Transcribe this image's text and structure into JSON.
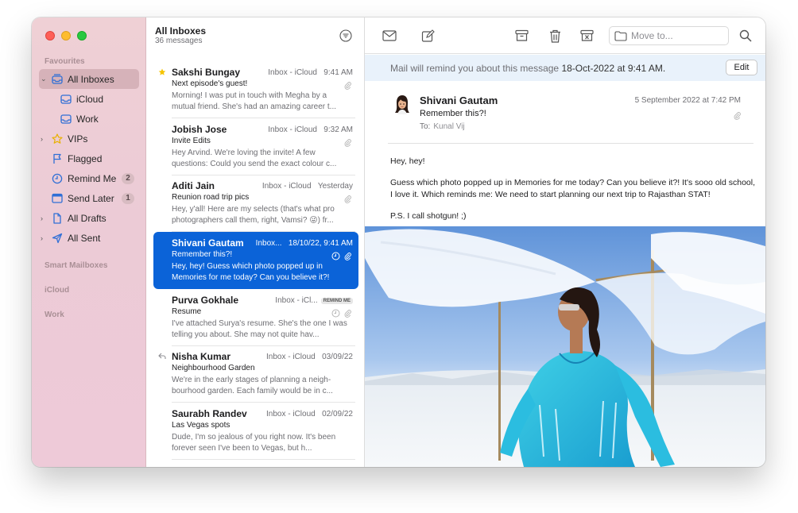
{
  "sidebar": {
    "sections": {
      "favourites": "Favourites",
      "smart": "Smart Mailboxes",
      "icloud": "iCloud",
      "work": "Work"
    },
    "items": [
      {
        "label": "All Inboxes",
        "icon": "inbox-stack-icon",
        "selected": true
      },
      {
        "label": "iCloud",
        "icon": "inbox-icon"
      },
      {
        "label": "Work",
        "icon": "inbox-icon"
      },
      {
        "label": "VIPs",
        "icon": "star-icon"
      },
      {
        "label": "Flagged",
        "icon": "flag-icon"
      },
      {
        "label": "Remind Me",
        "icon": "clock-icon",
        "badge": "2"
      },
      {
        "label": "Send Later",
        "icon": "calendar-icon",
        "badge": "1"
      },
      {
        "label": "All Drafts",
        "icon": "document-icon"
      },
      {
        "label": "All Sent",
        "icon": "paperplane-icon"
      }
    ]
  },
  "list": {
    "title": "All Inboxes",
    "count": "36 messages",
    "messages": [
      {
        "sender": "Sakshi Bungay",
        "meta": "Inbox - iCloud",
        "time": "9:41 AM",
        "subject": "Next episode's guest!",
        "preview": "Morning! I was put in touch with Megha by a mutual friend. She's had an amazing career t..."
      },
      {
        "sender": "Jobish Jose",
        "meta": "Inbox - iCloud",
        "time": "9:32 AM",
        "subject": "Invite Edits",
        "preview": "Hey Arvind. We're loving the invite! A few questions: Could you send the exact colour c..."
      },
      {
        "sender": "Aditi Jain",
        "meta": "Inbox - iCloud",
        "time": "Yesterday",
        "subject": "Reunion road trip pics",
        "preview": "Hey, y'all! Here are my selects (that's what pro photographers call them, right, Vamsi? 😜) fr..."
      },
      {
        "sender": "Shivani Gautam",
        "meta": "Inbox...",
        "time": "18/10/22, 9:41 AM",
        "subject": "Remember this?!",
        "preview": "Hey, hey! Guess which photo popped up in Memories for me today? Can you believe it?!"
      },
      {
        "sender": "Purva Gokhale",
        "meta": "Inbox - iCl...",
        "tag": "REMIND ME",
        "subject": "Resume",
        "preview": "I've attached Surya's resume. She's the one I was telling you about. She may not quite hav..."
      },
      {
        "sender": "Nisha Kumar",
        "meta": "Inbox - iCloud",
        "time": "03/09/22",
        "subject": "Neighbourhood Garden",
        "preview": "We're in the early stages of planning a neigh-bourhood garden. Each family would be in c..."
      },
      {
        "sender": "Saurabh Randev",
        "meta": "Inbox - iCloud",
        "time": "02/09/22",
        "subject": "Las Vegas spots",
        "preview": "Dude, I'm so jealous of you right now. It's been forever seen I've been to Vegas, but h..."
      }
    ]
  },
  "toolbar": {
    "move_to_placeholder": "Move to..."
  },
  "banner": {
    "prefix": "Mail will remind you about this message",
    "when": "18-Oct-2022 at 9:41 AM.",
    "edit_label": "Edit"
  },
  "message": {
    "from": "Shivani Gautam",
    "date": "5 September 2022 at 7:42 PM",
    "subject": "Remember this?!",
    "to_label": "To:",
    "to_value": "Kunal Vij",
    "body": [
      "Hey, hey!",
      "Guess which photo popped up in Memories for me today? Can you believe it?! It's sooo old school, I love it. Which reminds me: We need to start planning our next trip to Rajasthan STAT!",
      "P.S. I call shotgun! ;)"
    ]
  },
  "colors": {
    "accent": "#0b63d8",
    "sidebar_tint": "#efd0d5",
    "star": "#f5c400"
  }
}
